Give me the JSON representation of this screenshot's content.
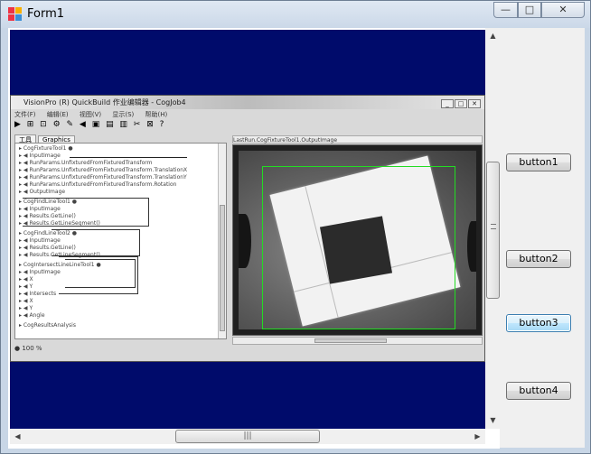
{
  "window": {
    "title": "Form1",
    "min_glyph": "—",
    "max_glyph": "□",
    "close_glyph": "✕"
  },
  "colors": {
    "panel_navy": "#000b6b",
    "focus_border": "#3c7fb1"
  },
  "panel": {
    "vscroll": {
      "up": "▲",
      "down": "▼",
      "thumb_grip": "≡"
    },
    "hscroll": {
      "left": "◀",
      "right": "▶",
      "thumb_grip": "|||"
    }
  },
  "embedded_app": {
    "title": "VisionPro (R) QuickBuild 作业编辑器 - CogJob4",
    "win_buttons": [
      "_",
      "□",
      "✕"
    ],
    "menu": [
      "文件(F)",
      "编辑(E)",
      "视图(V)",
      "显示(S)",
      "帮助(H)"
    ],
    "toolbar": "▶ ⊞ ⊡ ⚙ ✎ ◀ ▣ ▤ ▥ ✂ ⊠ ?",
    "tabs": [
      "工具",
      "Graphics"
    ],
    "tree_lines": [
      "▸ CogFixtureTool1 ●",
      "  ▸ ◀ InputImage",
      "  ▸ ◀ RunParams.UnfixturedFromFixturedTransform",
      "  ▸ ◀ RunParams.UnfixturedFromFixturedTransform.TranslationX",
      "  ▸ ◀ RunParams.UnfixturedFromFixturedTransform.TranslationY",
      "  ▸ ◀ RunParams.UnfixturedFromFixturedTransform.Rotation",
      "  ▸ ◀ OutputImage",
      "▸ CogFindLineTool1 ●",
      "  ▸ ◀ InputImage",
      "  ▸ ◀ Results.GetLine()",
      "  ▸ ◀ Results.GetLineSegment()",
      "▸ CogFindLineTool2 ●",
      "  ▸ ◀ InputImage",
      "  ▸ ◀ Results.GetLine()",
      "  ▸ ◀ Results.GetLineSegment()",
      "▸ CogIntersectLineLineTool1 ●",
      "  ▸ ◀ InputImage",
      "  ▸ ◀ X",
      "  ▸ ◀ Y",
      "  ▸ ◀ Intersects",
      "  ▸ ◀ X",
      "  ▸ ◀ Y",
      "  ▸ ◀ Angle",
      "▸ CogResultsAnalysis"
    ],
    "image_pane_label": "LastRun.CogFixtureTool1.OutputImage",
    "status": "● 100 %"
  },
  "buttons": [
    {
      "label": "button1"
    },
    {
      "label": "button2"
    },
    {
      "label": "button3",
      "focused": true
    },
    {
      "label": "button4"
    }
  ]
}
